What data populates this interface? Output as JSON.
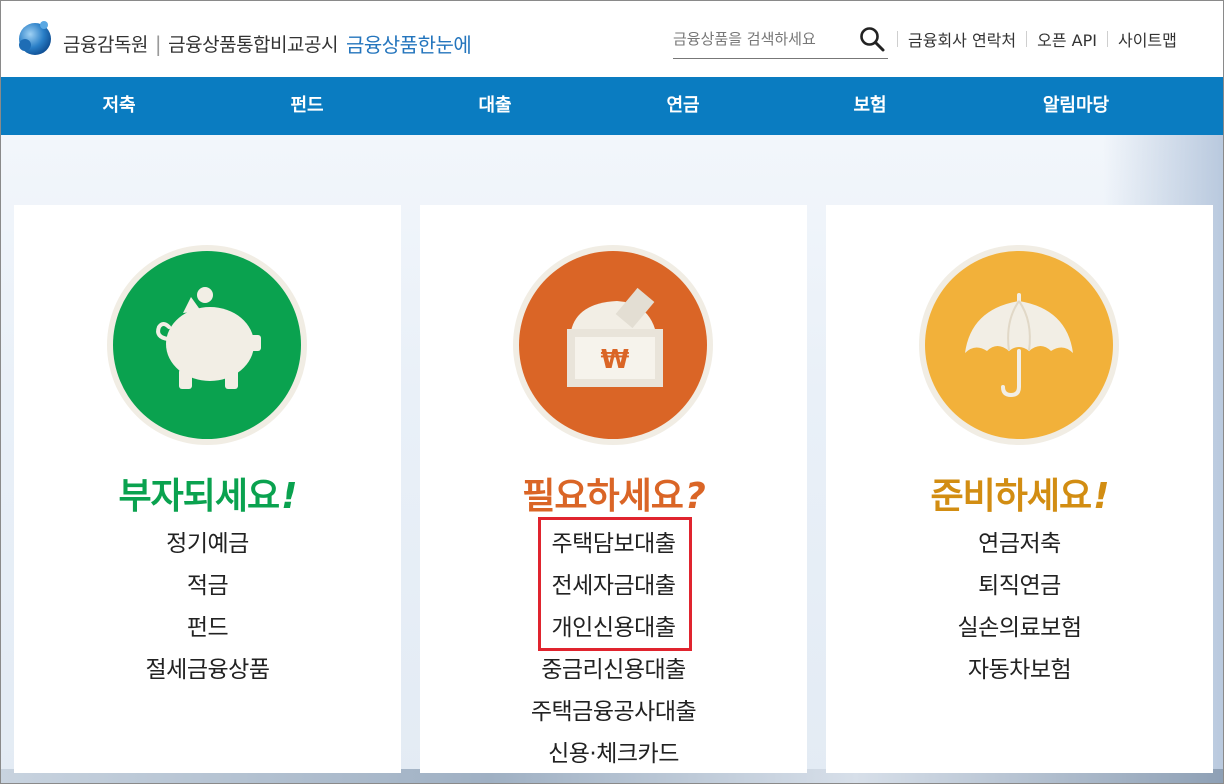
{
  "header": {
    "brand_org": "금융감독원",
    "brand_site": "금융상품통합비교공시",
    "brand_accent": "금융상품한눈에",
    "search_placeholder": "금융상품을 검색하세요",
    "top_links": [
      "금융회사 연락처",
      "오픈 API",
      "사이트맵"
    ]
  },
  "nav": {
    "items": [
      "저축",
      "펀드",
      "대출",
      "연금",
      "보험",
      "알림마당"
    ]
  },
  "cards": [
    {
      "title": "부자되세요",
      "mark": "!",
      "icon": "piggy-bank-icon",
      "color": "#0aa24f",
      "items": [
        "정기예금",
        "적금",
        "펀드",
        "절세금융상품"
      ]
    },
    {
      "title": "필요하세요",
      "mark": "?",
      "icon": "money-box-icon",
      "color": "#da6526",
      "items": [
        "주택담보대출",
        "전세자금대출",
        "개인신용대출",
        "중금리신용대출",
        "주택금융공사대출",
        "신용·체크카드"
      ]
    },
    {
      "title": "준비하세요",
      "mark": "!",
      "icon": "umbrella-icon",
      "color": "#f2b13a",
      "title_color": "#d28d12",
      "items": [
        "연금저축",
        "퇴직연금",
        "실손의료보험",
        "자동차보험"
      ]
    }
  ],
  "colors": {
    "nav_bg": "#0a7cc1",
    "brand_accent": "#2475bd",
    "highlight": "#e0242e"
  }
}
